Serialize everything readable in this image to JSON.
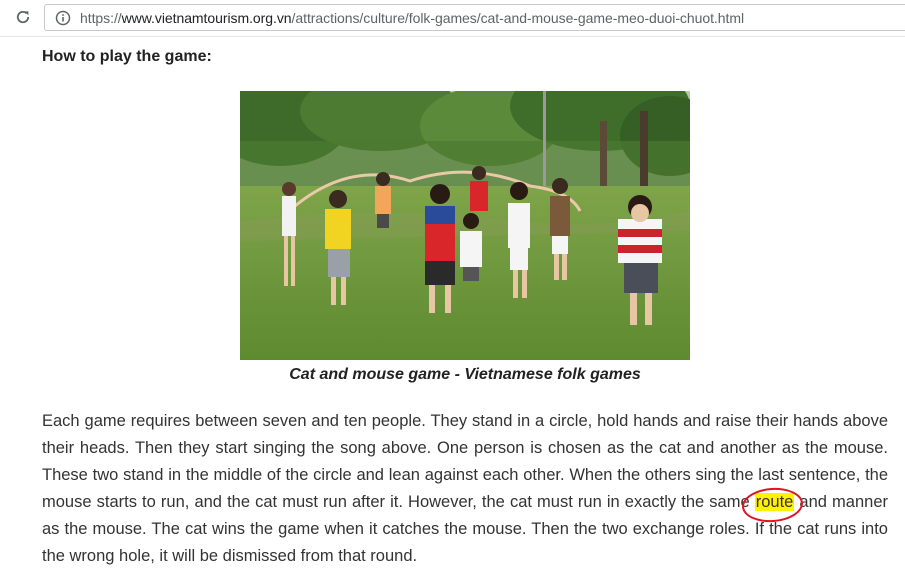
{
  "browser": {
    "url_scheme": "https://",
    "url_host": "www.vietnamtourism.org.vn",
    "url_path": "/attractions/culture/folk-games/cat-and-mouse-game-meo-duoi-chuot.html",
    "reload_icon": "reload-icon",
    "info_icon": "info-icon"
  },
  "article": {
    "heading": "How to play the game:",
    "caption": "Cat and mouse game - Vietnamese folk games",
    "paragraph_before": "Each game requires between seven and ten people. They stand in a circle, hold hands and raise their hands above their heads. Then they start singing the song above. One person is chosen as the cat and another as the mouse. These two stand in the middle of the circle and lean against each other. When the others sing the last sentence, the mouse starts to run, and the cat must run after it. However, the cat must run in exactly the same ",
    "highlighted_word": "route",
    "paragraph_after": " and manner as the mouse. The cat wins the game when it catches the mouse. Then the two exchange roles. If the cat runs into the wrong hole, it will be dismissed from that round."
  },
  "colors": {
    "highlight": "#fff200",
    "annotation_circle": "#e0141e",
    "grass": "#6f9a3a"
  }
}
